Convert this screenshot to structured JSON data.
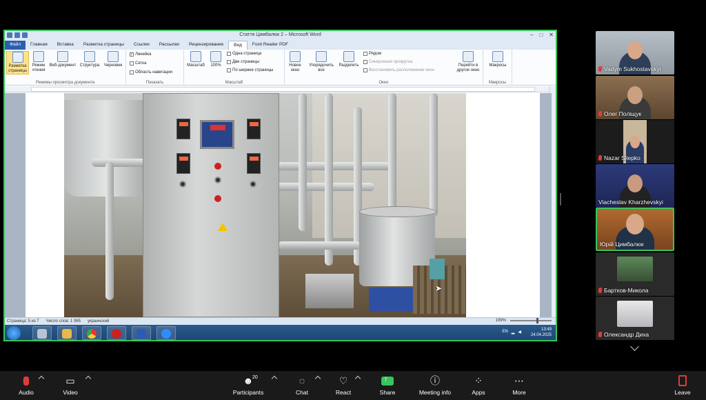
{
  "word": {
    "title": "Стаття Цимбалюк 2 – Microsoft Word",
    "tabs": [
      "Файл",
      "Главная",
      "Вставка",
      "Разметка страницы",
      "Ссылки",
      "Рассылки",
      "Рецензирование",
      "Вид",
      "Foxit Reader PDF"
    ],
    "active_tab": "Вид",
    "ribbon": {
      "views": [
        "Разметка страницы",
        "Режим чтения",
        "Веб-документ",
        "Структура",
        "Черновик"
      ],
      "views_group": "Режимы просмотра документа",
      "show": [
        "Линейка",
        "Сетка",
        "Область навигации"
      ],
      "show_group": "Показать",
      "zoom": [
        "Масштаб",
        "100%"
      ],
      "zoom_options": [
        "Одна страница",
        "Две страницы",
        "По ширине страницы"
      ],
      "zoom_group": "Масштаб",
      "window_btns": [
        "Новое окно",
        "Упорядочить все",
        "Разделить"
      ],
      "window_opts": [
        "Рядом",
        "Синхронная прокрутка",
        "Восстановить расположение окон"
      ],
      "switch": "Перейти в другое окно",
      "window_group": "Окно",
      "macros": "Макросы",
      "macros_group": "Макросы"
    },
    "status": {
      "page": "Страница: 5 из 7",
      "words": "Число слов: 1 965",
      "lang": "украинский",
      "zoom": "199%"
    },
    "tray": {
      "lang": "EN",
      "time": "13:49",
      "date": "24.04.2025"
    }
  },
  "participants": [
    {
      "name": "Vadym Sukhostavskyi",
      "muted": true
    },
    {
      "name": "Олег Поліщук",
      "muted": true
    },
    {
      "name": "Nazar Sliepko",
      "muted": true
    },
    {
      "name": "Viacheslav Kharzhevskyi",
      "muted": false
    },
    {
      "name": "Юрій Цимбалюк",
      "muted": false,
      "active": true
    },
    {
      "name": "Бартков-Микола",
      "muted": true
    },
    {
      "name": "Олександр Диха",
      "muted": true
    }
  ],
  "toolbar": {
    "audio": "Audio",
    "video": "Video",
    "participants": "Participants",
    "participants_count": "20",
    "chat": "Chat",
    "react": "React",
    "share": "Share",
    "meeting_info": "Meeting info",
    "apps": "Apps",
    "more": "More",
    "leave": "Leave"
  }
}
